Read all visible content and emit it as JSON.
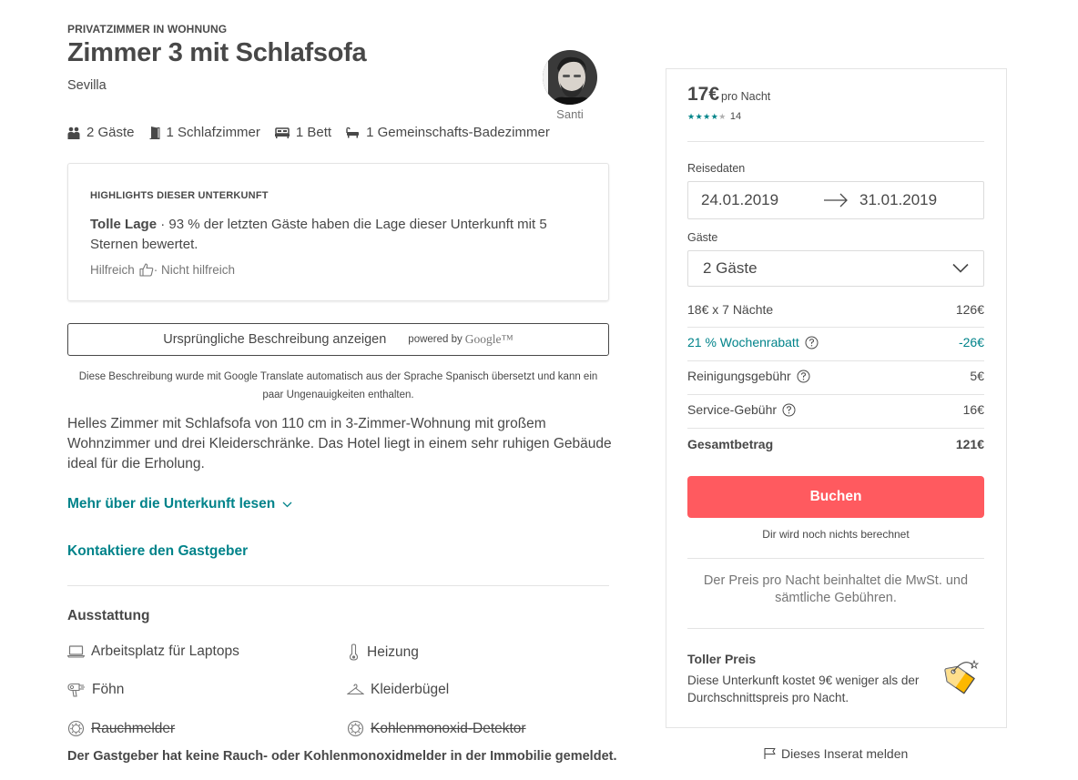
{
  "listing": {
    "room_type": "PRIVATZIMMER IN WOHNUNG",
    "title": "Zimmer 3 mit Schlafsofa",
    "city": "Sevilla",
    "host_name": "Santi",
    "facts": {
      "guests": "2 Gäste",
      "bedrooms": "1 Schlafzimmer",
      "beds": "1 Bett",
      "baths": "1 Gemeinschafts-Badezimmer"
    }
  },
  "highlights": {
    "heading": "HIGHLIGHTS DIESER UNTERKUNFT",
    "item_title": "Tolle Lage",
    "item_text": " · 93 % der letzten Gäste haben die Lage dieser Unterkunft mit 5 Sternen bewertet.",
    "helpful": "Hilfreich",
    "not_helpful": " · Nicht hilfreich"
  },
  "translation": {
    "button_label": "Ursprüngliche Beschreibung anzeigen",
    "powered_by": "powered by",
    "google": "Google™",
    "note": "Diese Beschreibung wurde mit Google Translate automatisch aus der Sprache Spanisch übersetzt und kann ein paar Ungenauigkeiten enthalten."
  },
  "description": {
    "text": "Helles Zimmer mit Schlafsofa von 110 cm in 3-Zimmer-Wohnung mit großem Wohnzimmer und drei Kleiderschränke. Das Hotel liegt in einem sehr ruhigen Gebäude ideal für die Erholung.",
    "more_link": "Mehr über die Unterkunft lesen",
    "contact_link": "Kontaktiere den Gastgeber"
  },
  "amenities": {
    "title": "Ausstattung",
    "items": [
      {
        "label": "Arbeitsplatz für Laptops",
        "icon": "laptop-icon",
        "unavailable": false
      },
      {
        "label": "Heizung",
        "icon": "thermometer-icon",
        "unavailable": false
      },
      {
        "label": "Föhn",
        "icon": "hair-dryer-icon",
        "unavailable": false
      },
      {
        "label": "Kleiderbügel",
        "icon": "hanger-icon",
        "unavailable": false
      },
      {
        "label": "Rauchmelder",
        "icon": "smoke-detector-icon",
        "unavailable": true
      },
      {
        "label": "Kohlenmonoxid-Detektor",
        "icon": "co-detector-icon",
        "unavailable": true
      }
    ],
    "note": "Der Gastgeber hat keine Rauch- oder Kohlenmonoxidmelder in der Immobilie gemeldet."
  },
  "booking": {
    "price": "17€",
    "price_unit": "pro Nacht",
    "rating_stars": 4,
    "rating_max": 5,
    "review_count": "14",
    "dates_label": "Reisedaten",
    "check_in": "24.01.2019",
    "check_out": "31.01.2019",
    "guests_label": "Gäste",
    "guests_value": "2 Gäste",
    "lines": [
      {
        "label": "18€ x 7 Nächte",
        "amount": "126€"
      },
      {
        "label": "21 % Wochenrabatt",
        "amount": "-26€"
      },
      {
        "label": "Reinigungsgebühr",
        "amount": "5€"
      },
      {
        "label": "Service-Gebühr",
        "amount": "16€"
      },
      {
        "label": "Gesamtbetrag",
        "amount": "121€"
      }
    ],
    "book_button": "Buchen",
    "no_charge": "Dir wird noch nichts berechnet",
    "vat_note": "Der Preis pro Nacht beinhaltet die MwSt. und sämtliche Gebühren.",
    "deal_title": "Toller Preis",
    "deal_text": "Diese Unterkunft kostet 9€ weniger als der Durchschnittspreis pro Nacht.",
    "report_link": "Dieses Inserat melden"
  },
  "colors": {
    "accent_teal": "#00838a",
    "book_button": "#ff5a5f",
    "text": "#484848",
    "muted": "#767676"
  }
}
